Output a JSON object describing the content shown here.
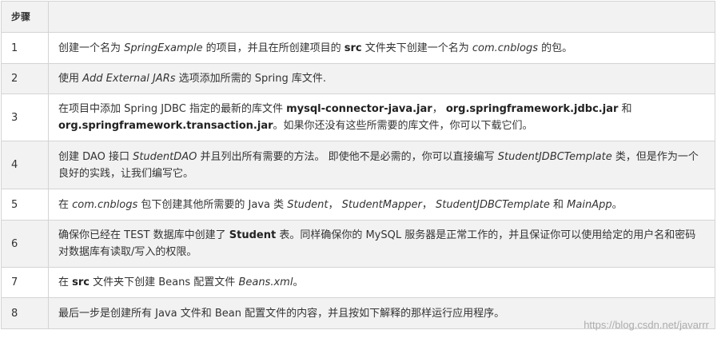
{
  "table": {
    "header": {
      "col1": "步骤",
      "col2": ""
    },
    "rows": [
      {
        "num": "1",
        "parts": [
          {
            "t": "创建一个名为 "
          },
          {
            "t": "SpringExample",
            "s": "i"
          },
          {
            "t": " 的项目，并且在所创建项目的 "
          },
          {
            "t": "src",
            "s": "b"
          },
          {
            "t": " 文件夹下创建一个名为 "
          },
          {
            "t": "com.cnblogs",
            "s": "i"
          },
          {
            "t": " 的包。"
          }
        ]
      },
      {
        "num": "2",
        "parts": [
          {
            "t": "使用 "
          },
          {
            "t": "Add External JARs",
            "s": "i"
          },
          {
            "t": " 选项添加所需的 Spring 库文件."
          }
        ]
      },
      {
        "num": "3",
        "parts": [
          {
            "t": "在项目中添加 Spring JDBC 指定的最新的库文件 "
          },
          {
            "t": "mysql-connector-java.jar",
            "s": "b"
          },
          {
            "t": "， "
          },
          {
            "t": "org.springframework.jdbc.jar",
            "s": "b"
          },
          {
            "t": " 和 "
          },
          {
            "t": "org.springframework.transaction.jar",
            "s": "b"
          },
          {
            "t": "。如果你还没有这些所需要的库文件，你可以下载它们。"
          }
        ]
      },
      {
        "num": "4",
        "parts": [
          {
            "t": "创建 DAO 接口 "
          },
          {
            "t": "StudentDAO",
            "s": "i"
          },
          {
            "t": " 并且列出所有需要的方法。 即使他不是必需的，你可以直接编写 "
          },
          {
            "t": "StudentJDBCTemplate",
            "s": "i"
          },
          {
            "t": " 类，但是作为一个良好的实践，让我们编写它。"
          }
        ]
      },
      {
        "num": "5",
        "parts": [
          {
            "t": "在 "
          },
          {
            "t": "com.cnblogs",
            "s": "i"
          },
          {
            "t": " 包下创建其他所需要的 Java 类 "
          },
          {
            "t": "Student",
            "s": "i"
          },
          {
            "t": "， "
          },
          {
            "t": "StudentMapper",
            "s": "i"
          },
          {
            "t": "， "
          },
          {
            "t": "StudentJDBCTemplate",
            "s": "i"
          },
          {
            "t": " 和 "
          },
          {
            "t": "MainApp",
            "s": "i"
          },
          {
            "t": "。"
          }
        ]
      },
      {
        "num": "6",
        "parts": [
          {
            "t": "确保你已经在 TEST 数据库中创建了 "
          },
          {
            "t": "Student",
            "s": "b"
          },
          {
            "t": " 表。同样确保你的 MySQL 服务器是正常工作的，并且保证你可以使用给定的用户名和密码对数据库有读取/写入的权限。"
          }
        ]
      },
      {
        "num": "7",
        "parts": [
          {
            "t": "在 "
          },
          {
            "t": "src",
            "s": "b"
          },
          {
            "t": " 文件夹下创建 Beans 配置文件 "
          },
          {
            "t": "Beans.xml",
            "s": "i"
          },
          {
            "t": "。"
          }
        ]
      },
      {
        "num": "8",
        "parts": [
          {
            "t": "最后一步是创建所有 Java 文件和 Bean 配置文件的内容，并且按如下解释的那样运行应用程序。"
          }
        ]
      }
    ]
  },
  "watermark": "https://blog.csdn.net/javarrr"
}
